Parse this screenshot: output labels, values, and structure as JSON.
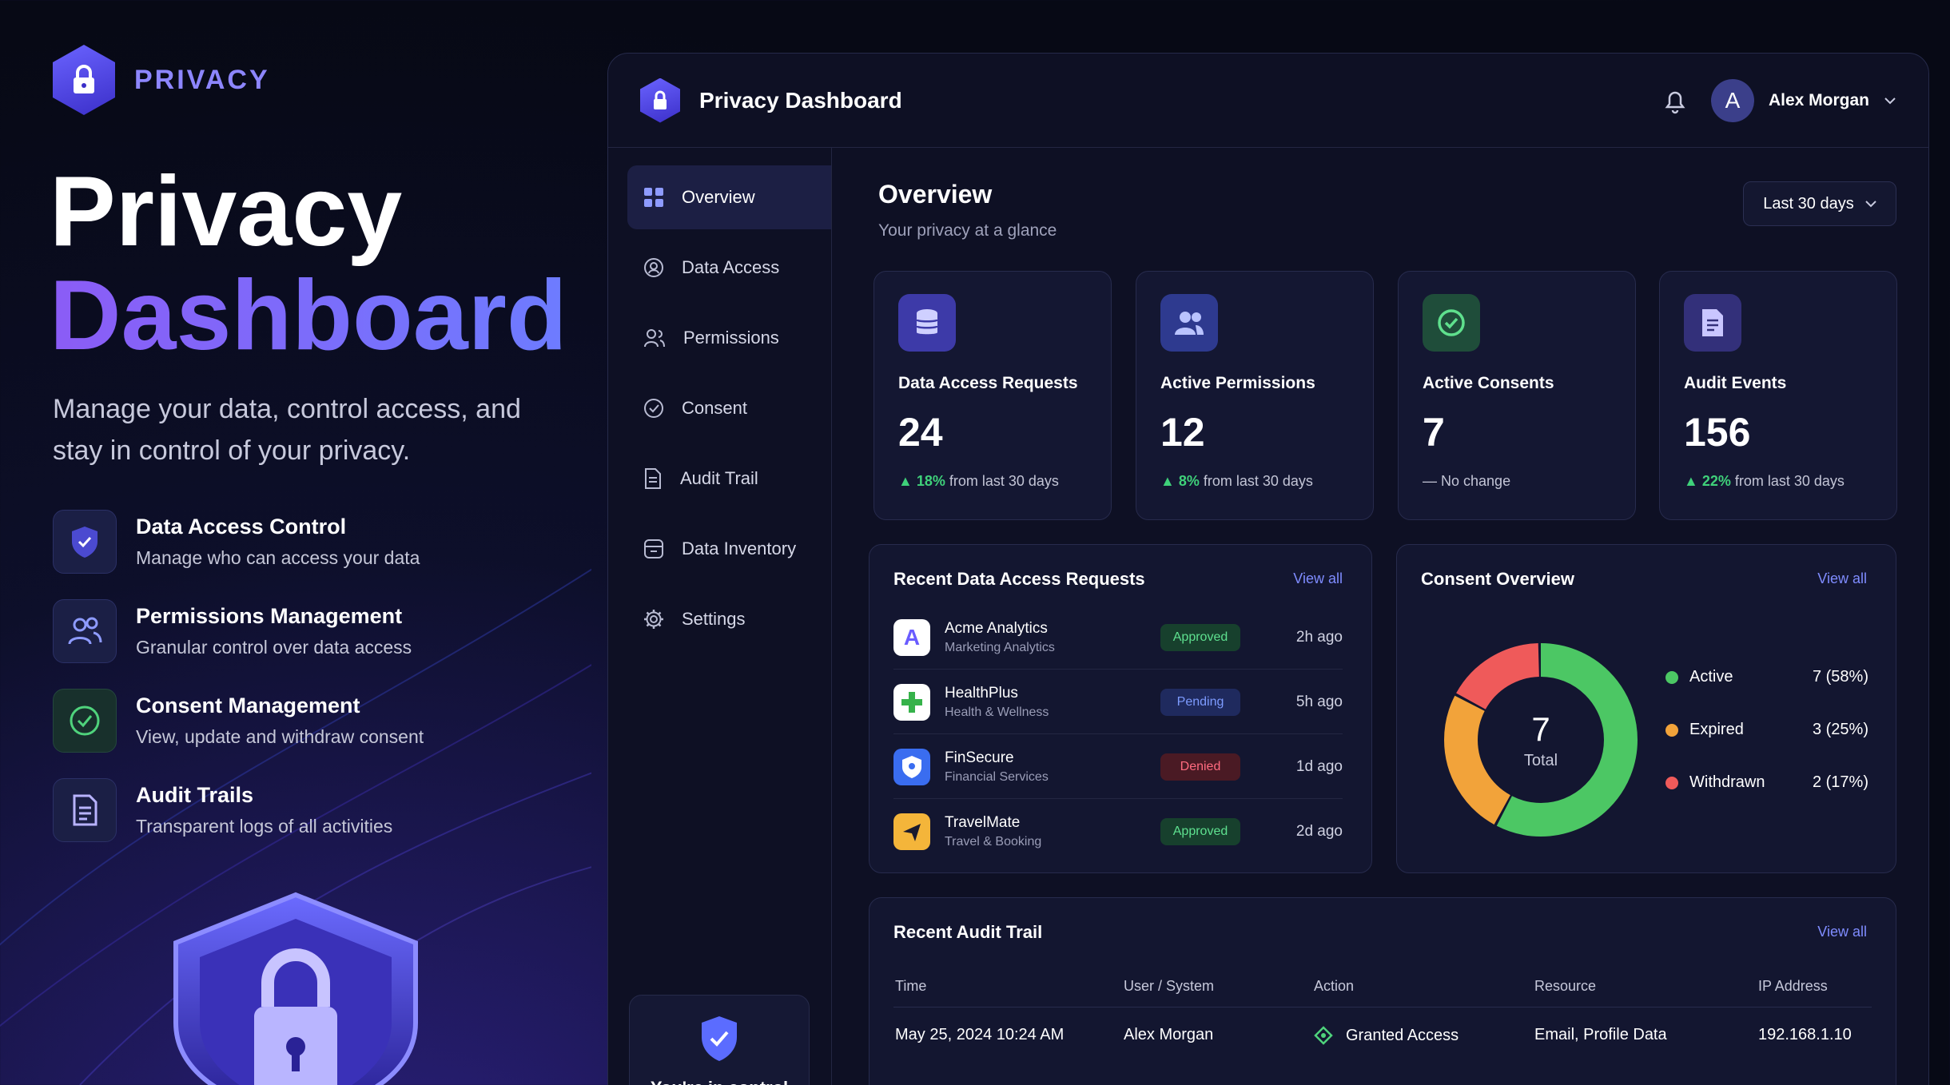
{
  "hero": {
    "brand": "PRIVACY",
    "title_line1": "Privacy",
    "title_line2": "Dashboard",
    "subtitle": "Manage your data, control access, and stay in control of your privacy.",
    "features": [
      {
        "title": "Data Access Control",
        "desc": "Manage who can access your data",
        "icon": "shield-check-icon"
      },
      {
        "title": "Permissions Management",
        "desc": "Granular control over data access",
        "icon": "users-icon"
      },
      {
        "title": "Consent Management",
        "desc": "View, update and withdraw consent",
        "icon": "check-circle-icon"
      },
      {
        "title": "Audit Trails",
        "desc": "Transparent logs of all activities",
        "icon": "document-icon"
      }
    ]
  },
  "header": {
    "title": "Privacy Dashboard",
    "user_initial": "A",
    "user_name": "Alex Morgan"
  },
  "sidebar": {
    "items": [
      {
        "label": "Overview",
        "icon": "grid-icon",
        "active": true
      },
      {
        "label": "Data Access",
        "icon": "data-access-icon"
      },
      {
        "label": "Permissions",
        "icon": "users-icon"
      },
      {
        "label": "Consent",
        "icon": "check-circle-icon"
      },
      {
        "label": "Audit Trail",
        "icon": "document-icon"
      },
      {
        "label": "Data Inventory",
        "icon": "database-icon"
      },
      {
        "label": "Settings",
        "icon": "gear-icon"
      }
    ],
    "control_text": "You're in control"
  },
  "overview": {
    "title": "Overview",
    "subtitle": "Your privacy at a glance",
    "range": "Last 30 days"
  },
  "stats": [
    {
      "label": "Data Access Requests",
      "value": "24",
      "change": "18%",
      "change_text": "from last 30 days",
      "trend": "up",
      "color": "#3d3aa8"
    },
    {
      "label": "Active Permissions",
      "value": "12",
      "change": "8%",
      "change_text": "from last 30 days",
      "trend": "up",
      "color": "#2e3a8f"
    },
    {
      "label": "Active Consents",
      "value": "7",
      "change": "—",
      "change_text": "No change",
      "trend": "none",
      "color": "#1f4d3a"
    },
    {
      "label": "Audit Events",
      "value": "156",
      "change": "22%",
      "change_text": "from last 30 days",
      "trend": "up",
      "color": "#33307a"
    }
  ],
  "requests": {
    "title": "Recent Data Access Requests",
    "view_all": "View all",
    "rows": [
      {
        "name": "Acme Analytics",
        "category": "Marketing Analytics",
        "status": "Approved",
        "time": "2h ago",
        "logo": "A"
      },
      {
        "name": "HealthPlus",
        "category": "Health & Wellness",
        "status": "Pending",
        "time": "5h ago",
        "logo": "+"
      },
      {
        "name": "FinSecure",
        "category": "Financial Services",
        "status": "Denied",
        "time": "1d ago",
        "logo": "shield"
      },
      {
        "name": "TravelMate",
        "category": "Travel & Booking",
        "status": "Approved",
        "time": "2d ago",
        "logo": "plane"
      }
    ]
  },
  "consent": {
    "title": "Consent Overview",
    "view_all": "View all",
    "total": "7",
    "total_label": "Total",
    "items": [
      {
        "label": "Active",
        "value": "7 (58%)",
        "fraction": 0.58,
        "color": "#4cc764"
      },
      {
        "label": "Expired",
        "value": "3 (25%)",
        "fraction": 0.25,
        "color": "#f2a33a"
      },
      {
        "label": "Withdrawn",
        "value": "2 (17%)",
        "fraction": 0.17,
        "color": "#ef5a5a"
      }
    ]
  },
  "audit": {
    "title": "Recent Audit Trail",
    "view_all": "View all",
    "headers": [
      "Time",
      "User / System",
      "Action",
      "Resource",
      "IP Address"
    ],
    "rows": [
      {
        "time": "May 25, 2024 10:24 AM",
        "user": "Alex Morgan",
        "action": "Granted Access",
        "resource": "Email, Profile Data",
        "ip": "192.168.1.10"
      }
    ]
  }
}
